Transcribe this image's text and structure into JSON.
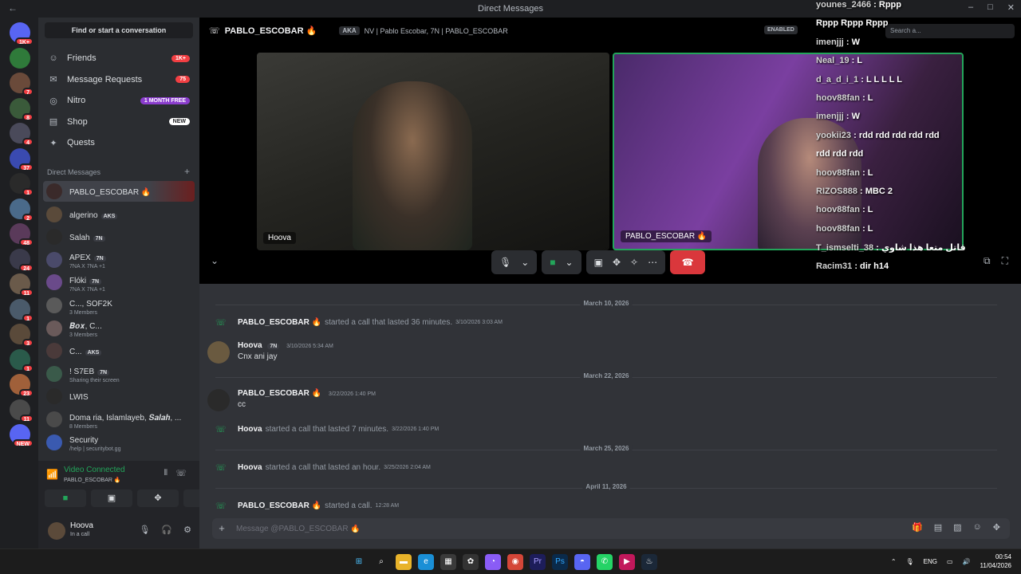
{
  "window": {
    "title": "Direct Messages",
    "back_icon": "←",
    "controls": [
      "–",
      "□",
      "✕"
    ]
  },
  "guilds": [
    {
      "badge": "1K+"
    },
    {
      "badge": ""
    },
    {
      "badge": "7"
    },
    {
      "badge": "8"
    },
    {
      "badge": "4"
    },
    {
      "badge": "37"
    },
    {
      "badge": "1"
    },
    {
      "badge": "2"
    },
    {
      "badge": "48"
    },
    {
      "badge": "24"
    },
    {
      "badge": "11"
    },
    {
      "badge": "1"
    },
    {
      "badge": "3"
    },
    {
      "badge": "1"
    },
    {
      "badge": "23"
    },
    {
      "badge": "11"
    },
    {
      "badge": "NEW"
    }
  ],
  "sidebar": {
    "find": "Find or start a conversation",
    "nav": [
      {
        "icon": "☺",
        "label": "Friends",
        "pill": "1K+",
        "pill_style": "red"
      },
      {
        "icon": "✉",
        "label": "Message Requests",
        "pill": "75",
        "pill_style": "red"
      },
      {
        "icon": "◎",
        "label": "Nitro",
        "pill": "1 MONTH FREE",
        "pill_style": "purple"
      },
      {
        "icon": "▤",
        "label": "Shop",
        "pill": "NEW",
        "pill_style": "white"
      },
      {
        "icon": "✦",
        "label": "Quests",
        "pill": "",
        "pill_style": "none"
      }
    ],
    "dm_header": "Direct Messages",
    "dms": [
      {
        "name": "PABLO_ESCOBAR 🔥",
        "tag": "",
        "sub": "",
        "active": true
      },
      {
        "name": "algerino",
        "tag": "AKS",
        "sub": ""
      },
      {
        "name": "Salah",
        "tag": "7N",
        "sub": ""
      },
      {
        "name": "APEX",
        "tag": "7N",
        "sub": "7NA X 7NA +1"
      },
      {
        "name": "Flóki",
        "tag": "7N",
        "sub": "7NA X 7NA +1"
      },
      {
        "name": "C..., SOF2K",
        "tag": "",
        "sub": "3 Members"
      },
      {
        "name": "𝑩𝒐𝒙, C...",
        "tag": "",
        "sub": "3 Members"
      },
      {
        "name": "C...",
        "tag": "AKS",
        "sub": ""
      },
      {
        "name": "! S7EB",
        "tag": "7N",
        "sub": "Sharing their screen"
      },
      {
        "name": "LWIS",
        "tag": "",
        "sub": ""
      },
      {
        "name": "Doma ria, Islamlayeb, 𝑺𝒂𝒍𝒂𝒉, ...",
        "tag": "",
        "sub": "8 Members"
      },
      {
        "name": "Security",
        "tag": "",
        "sub": "/help | securitybot.gg"
      }
    ]
  },
  "voice": {
    "status": "Video Connected",
    "channel": "PABLO_ESCOBAR 🔥"
  },
  "user": {
    "name": "Hoova",
    "status": "In a call"
  },
  "call": {
    "peer_name": "PABLO_ESCOBAR 🔥",
    "aka_label": "AKA",
    "aka_text": "NV | Pablo Escobar, 7N | PABLO_ESCOBAR",
    "enabled_label": "ENABLED",
    "search_placeholder": "Search a...",
    "tile1_label": "Hoova",
    "tile2_label": "PABLO_ESCOBAR 🔥"
  },
  "chat": {
    "dividers": [
      "March 10, 2026",
      "March 22, 2026",
      "March 25, 2026",
      "April 11, 2026"
    ],
    "sys1": {
      "who": "PABLO_ESCOBAR 🔥",
      "what": "started a call that lasted 36 minutes.",
      "when": "3/10/2026 3:03 AM"
    },
    "msg1": {
      "who": "Hoova",
      "tag": "7N",
      "when": "3/10/2026 5:34 AM",
      "body": "Cnx ani jay"
    },
    "msg2": {
      "who": "PABLO_ESCOBAR 🔥",
      "when": "3/22/2026 1:40 PM",
      "body": "cc"
    },
    "sys2": {
      "who": "Hoova",
      "what": "started a call that lasted 7 minutes.",
      "when": "3/22/2026 1:40 PM"
    },
    "sys3": {
      "who": "Hoova",
      "what": "started a call that lasted an hour.",
      "when": "3/25/2026 2:04 AM"
    },
    "sys4": {
      "who": "PABLO_ESCOBAR 🔥",
      "what": "started a call.",
      "when": "12:28 AM"
    },
    "composer_placeholder": "Message @PABLO_ESCOBAR 🔥"
  },
  "overlay_chat": [
    {
      "user": "younes_2466",
      "text": "Rppp"
    },
    {
      "user": "",
      "text": "Rppp     Rppp     Rppp"
    },
    {
      "user": "imenjjj",
      "text": "W"
    },
    {
      "user": "Neal_19",
      "text": "L"
    },
    {
      "user": "d_a_d_i_1",
      "text": "L  L  L  L  L"
    },
    {
      "user": "hoov88fan",
      "text": "L"
    },
    {
      "user": "imenjjj",
      "text": "W"
    },
    {
      "user": "yookii23",
      "text": "rdd  rdd  rdd  rdd  rdd"
    },
    {
      "user": "",
      "text": "rdd  rdd  rdd"
    },
    {
      "user": "hoov88fan",
      "text": "L"
    },
    {
      "user": "RIZOS888",
      "text": "MBC 2"
    },
    {
      "user": "hoov88fan",
      "text": "L"
    },
    {
      "user": "hoov88fan",
      "text": "L"
    },
    {
      "user": "T_ismselti_38",
      "text": "قاتل متعا هذا شاوي"
    },
    {
      "user": "Racim31",
      "text": "dir h14"
    }
  ],
  "taskbar": {
    "lang": "ENG",
    "time": "00:54",
    "date": "11/04/2026"
  }
}
